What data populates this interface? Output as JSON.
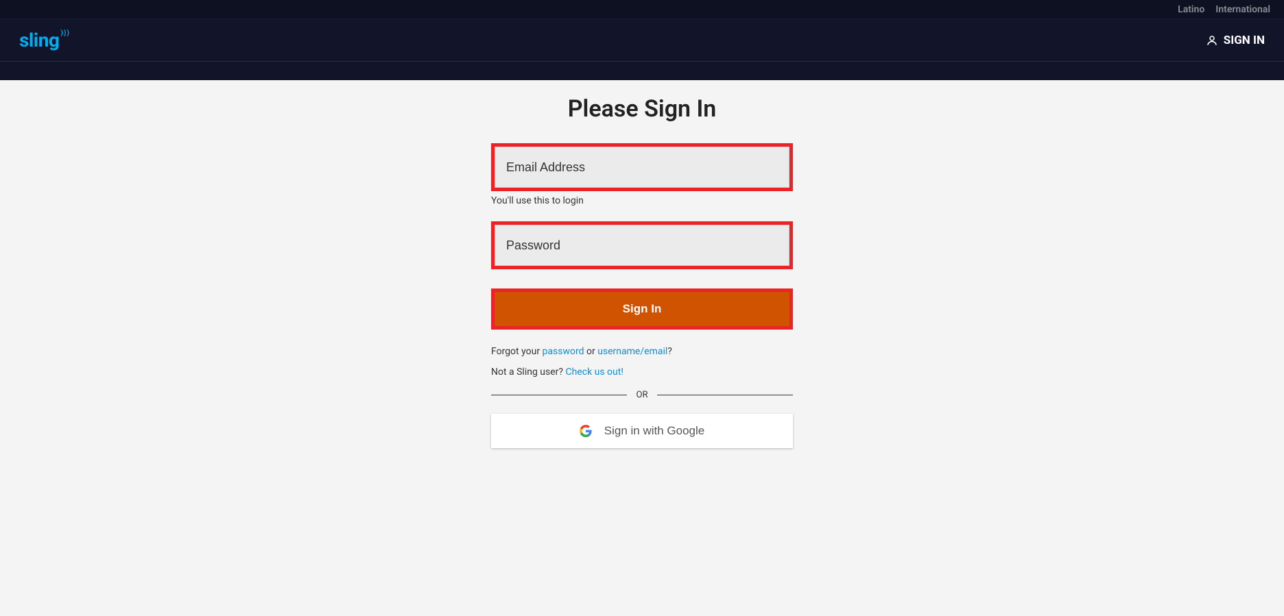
{
  "topbar": {
    "latino": "Latino",
    "international": "International"
  },
  "header": {
    "logo_text": "sling",
    "signin": "SIGN IN"
  },
  "page": {
    "title": "Please Sign In"
  },
  "form": {
    "email_placeholder": "Email Address",
    "email_hint": "You'll use this to login",
    "password_placeholder": "Password",
    "signin_button": "Sign In",
    "forgot_prefix": "Forgot your ",
    "forgot_password": "password",
    "forgot_or": " or ",
    "forgot_username": "username/email",
    "forgot_suffix": "?",
    "not_user_prefix": "Not a Sling user? ",
    "not_user_link": "Check us out!",
    "divider": "OR",
    "google_button": "Sign in with Google"
  }
}
